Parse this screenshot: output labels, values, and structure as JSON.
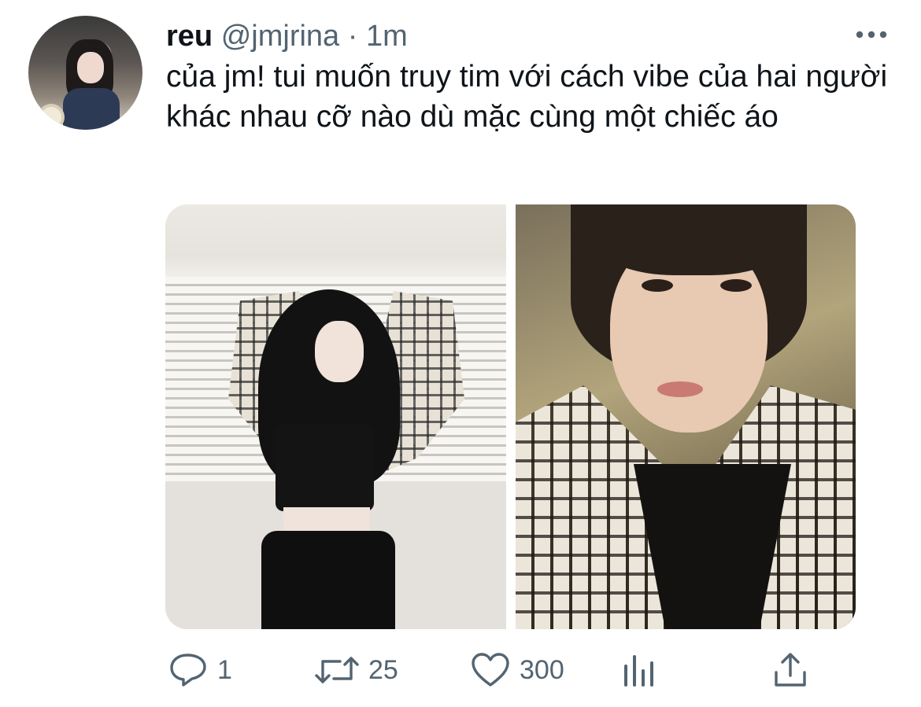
{
  "tweet": {
    "display_name": "reu",
    "handle": "@jmjrina",
    "separator": "·",
    "time": "1m",
    "text": "của jm! tui muốn truy tim với cách vibe của hai người khác nhau cỡ nào dù mặc cùng một chiếc áo",
    "more_icon": "more-horizontal-icon"
  },
  "actions": {
    "reply": {
      "icon": "reply-icon",
      "count": "1"
    },
    "retweet": {
      "icon": "retweet-icon",
      "count": "25"
    },
    "like": {
      "icon": "heart-icon",
      "count": "300"
    },
    "analytics": {
      "icon": "analytics-icon"
    },
    "share": {
      "icon": "share-icon"
    }
  },
  "colors": {
    "text": "#0f1419",
    "secondary": "#536471"
  }
}
